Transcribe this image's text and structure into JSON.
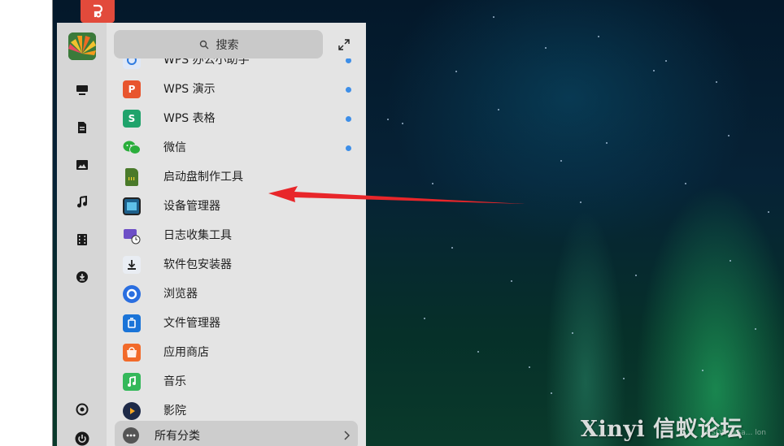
{
  "search": {
    "placeholder": "搜索"
  },
  "app_list": [
    {
      "label": "WPS 办公小助手",
      "icon": "wps-assistant-icon",
      "color": "#2f7be0",
      "new": true
    },
    {
      "label": "WPS 演示",
      "icon": "wps-presentation-icon",
      "color": "#e8552e",
      "new": true
    },
    {
      "label": "WPS 表格",
      "icon": "wps-spreadsheet-icon",
      "color": "#1fa36b",
      "new": true
    },
    {
      "label": "微信",
      "icon": "wechat-icon",
      "color": "#2aae3b",
      "new": true
    },
    {
      "label": "启动盘制作工具",
      "icon": "sd-card-icon",
      "color": "#4a7a2a",
      "new": false
    },
    {
      "label": "设备管理器",
      "icon": "device-manager-icon",
      "color": "#1d5f8a",
      "new": false
    },
    {
      "label": "日志收集工具",
      "icon": "log-collector-icon",
      "color": "#6d4fc6",
      "new": false
    },
    {
      "label": "软件包安装器",
      "icon": "package-installer-icon",
      "color": "#4b6f9e",
      "new": false
    },
    {
      "label": "浏览器",
      "icon": "browser-icon",
      "color": "#2a6ee0",
      "new": false
    },
    {
      "label": "文件管理器",
      "icon": "file-manager-icon",
      "color": "#1a74d8",
      "new": false
    },
    {
      "label": "应用商店",
      "icon": "app-store-icon",
      "color": "#f26a2a",
      "new": false
    },
    {
      "label": "音乐",
      "icon": "music-icon",
      "color": "#34b85a",
      "new": false
    },
    {
      "label": "影院",
      "icon": "movie-icon",
      "color": "#1e2a48",
      "new": false
    }
  ],
  "all_categories": {
    "label": "所有分类"
  },
  "rail_icons": [
    "computer-icon",
    "document-icon",
    "picture-icon",
    "music-note-icon",
    "video-icon",
    "download-icon",
    "settings-icon",
    "power-icon"
  ],
  "watermark": {
    "title": "Xinyi 信蚁论坛",
    "subtitle": "CSDN @Sa... lon"
  },
  "colors": {
    "accent_dot": "#3d8ee8",
    "arrow": "#e8262a"
  }
}
